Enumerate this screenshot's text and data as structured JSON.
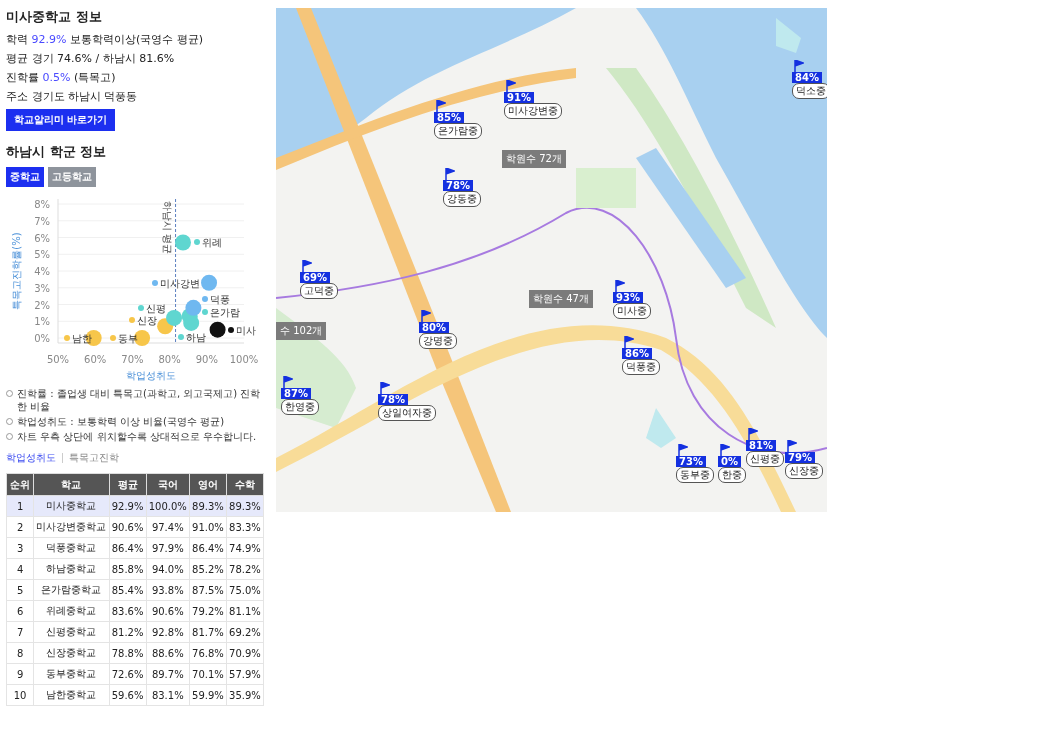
{
  "school": {
    "title": "미사중학교 정보",
    "lines": [
      {
        "label": "학력",
        "value": "92.9%",
        "rest": "보통학력이상(국영수 평균)"
      },
      {
        "label": "평균",
        "rest": "경기 74.6% / 하남시 81.6%"
      },
      {
        "label": "진학률",
        "value": "0.5%",
        "rest": "(특목고)"
      },
      {
        "label": "주소",
        "rest": "경기도 하남시 덕풍동"
      }
    ],
    "link_button": "학교알리미 바로가기"
  },
  "district": {
    "title": "하남시 학군 정보",
    "levels": [
      {
        "label": "중학교",
        "selected": true
      },
      {
        "label": "고등학교",
        "selected": false
      }
    ]
  },
  "chart_data": {
    "type": "scatter",
    "xlabel": "학업성취도",
    "ylabel": "특목고진학률(%)",
    "xlim": [
      50,
      100
    ],
    "ylim": [
      0,
      8
    ],
    "grid": true,
    "xticks": [
      {
        "value": 50,
        "label": "50%"
      },
      {
        "value": 60,
        "label": "60%"
      },
      {
        "value": 70,
        "label": "70%"
      },
      {
        "value": 80,
        "label": "80%"
      },
      {
        "value": 90,
        "label": "90%"
      },
      {
        "value": 100,
        "label": "100%"
      }
    ],
    "yticks": [
      {
        "value": 0,
        "label": "0%"
      },
      {
        "value": 1,
        "label": "1%"
      },
      {
        "value": 2,
        "label": "2%"
      },
      {
        "value": 3,
        "label": "3%"
      },
      {
        "value": 4,
        "label": "4%"
      },
      {
        "value": 5,
        "label": "5%"
      },
      {
        "value": 6,
        "label": "6%"
      },
      {
        "value": 7,
        "label": "7%"
      },
      {
        "value": 8,
        "label": "8%"
      }
    ],
    "series": [
      {
        "name": "남한",
        "color": "#f7c64a",
        "x": [
          59.6
        ],
        "values": [
          0
        ]
      },
      {
        "name": "동부",
        "color": "#f7c64a",
        "x": [
          72.6
        ],
        "values": [
          0
        ]
      },
      {
        "name": "신장",
        "color": "#f7c64a",
        "x": [
          78.8
        ],
        "values": [
          0.7
        ]
      },
      {
        "name": "신평",
        "color": "#5fd6d0",
        "x": [
          81.2
        ],
        "values": [
          1.2
        ]
      },
      {
        "name": "하남",
        "color": "#5fd6d0",
        "x": [
          85.8
        ],
        "values": [
          0.9
        ]
      },
      {
        "name": "은가람",
        "color": "#5fd6d0",
        "x": [
          85.4
        ],
        "values": [
          1.3
        ]
      },
      {
        "name": "덕풍",
        "color": "#6fb8f0",
        "x": [
          86.4
        ],
        "values": [
          1.8
        ]
      },
      {
        "name": "위례",
        "color": "#5fd6d0",
        "x": [
          83.6
        ],
        "values": [
          5.7
        ]
      },
      {
        "name": "미사강변",
        "color": "#6fb8f0",
        "x": [
          90.6
        ],
        "values": [
          3.3
        ]
      },
      {
        "name": "미사",
        "color": "#111111",
        "x": [
          92.9
        ],
        "values": [
          0.5
        ]
      }
    ],
    "legend": true,
    "ref_lines": [
      {
        "axis": "x",
        "value": 81.6,
        "label": "하남시 평균"
      }
    ]
  },
  "notes": [
    "진학률 : 졸업생 대비 특목고(과학고, 외고국제고) 진학한 비율",
    "학업성취도 : 보통학력 이상 비율(국영수 평균)",
    "차트 우측 상단에 위치할수록 상대적으로 우수합니다."
  ],
  "view_tabs": [
    {
      "label": "학업성취도",
      "selected": true
    },
    {
      "label": "특목고진학",
      "selected": false
    }
  ],
  "table": {
    "columns": [
      "순위",
      "학교",
      "평균",
      "국어",
      "영어",
      "수학"
    ],
    "rows": [
      {
        "cells": [
          "1",
          "미사중학교",
          "92.9%",
          "100.0%",
          "89.3%",
          "89.3%"
        ],
        "selected": true
      },
      {
        "cells": [
          "2",
          "미사강변중학교",
          "90.6%",
          "97.4%",
          "91.0%",
          "83.3%"
        ],
        "selected": false
      },
      {
        "cells": [
          "3",
          "덕풍중학교",
          "86.4%",
          "97.9%",
          "86.4%",
          "74.9%"
        ],
        "selected": false
      },
      {
        "cells": [
          "4",
          "하남중학교",
          "85.8%",
          "94.0%",
          "85.2%",
          "78.2%"
        ],
        "selected": false
      },
      {
        "cells": [
          "5",
          "은가람중학교",
          "85.4%",
          "93.8%",
          "87.5%",
          "75.0%"
        ],
        "selected": false
      },
      {
        "cells": [
          "6",
          "위례중학교",
          "83.6%",
          "90.6%",
          "79.2%",
          "81.1%"
        ],
        "selected": false
      },
      {
        "cells": [
          "7",
          "신평중학교",
          "81.2%",
          "92.8%",
          "81.7%",
          "69.2%"
        ],
        "selected": false
      },
      {
        "cells": [
          "8",
          "신장중학교",
          "78.8%",
          "88.6%",
          "76.8%",
          "70.9%"
        ],
        "selected": false
      },
      {
        "cells": [
          "9",
          "동부중학교",
          "72.6%",
          "89.7%",
          "70.1%",
          "57.9%"
        ],
        "selected": false
      },
      {
        "cells": [
          "10",
          "남한중학교",
          "59.6%",
          "83.1%",
          "59.9%",
          "35.9%"
        ],
        "selected": false
      }
    ]
  },
  "map": {
    "kind": "picture",
    "markers": [
      {
        "percent": "84%",
        "name": "덕소중"
      },
      {
        "percent": "91%",
        "name": "미사강변중"
      },
      {
        "percent": "85%",
        "name": "은가람중"
      },
      {
        "percent": "78%",
        "name": "강동중"
      },
      {
        "percent": "69%",
        "name": "고덕중"
      },
      {
        "percent": "93%",
        "name": "미사중"
      },
      {
        "percent": "80%",
        "name": "강명중"
      },
      {
        "percent": "86%",
        "name": "덕풍중"
      },
      {
        "percent": "87%",
        "name": "한영중"
      },
      {
        "percent": "78%",
        "name": "상일여자중"
      },
      {
        "percent": "73%",
        "name": "동부중"
      },
      {
        "percent": "0%",
        "name": "한중"
      },
      {
        "percent": "81%",
        "name": "신평중"
      },
      {
        "percent": "79%",
        "name": "신장중"
      }
    ],
    "counts": [
      "학원수 72개",
      "학원수 47개",
      "수 102개"
    ]
  }
}
